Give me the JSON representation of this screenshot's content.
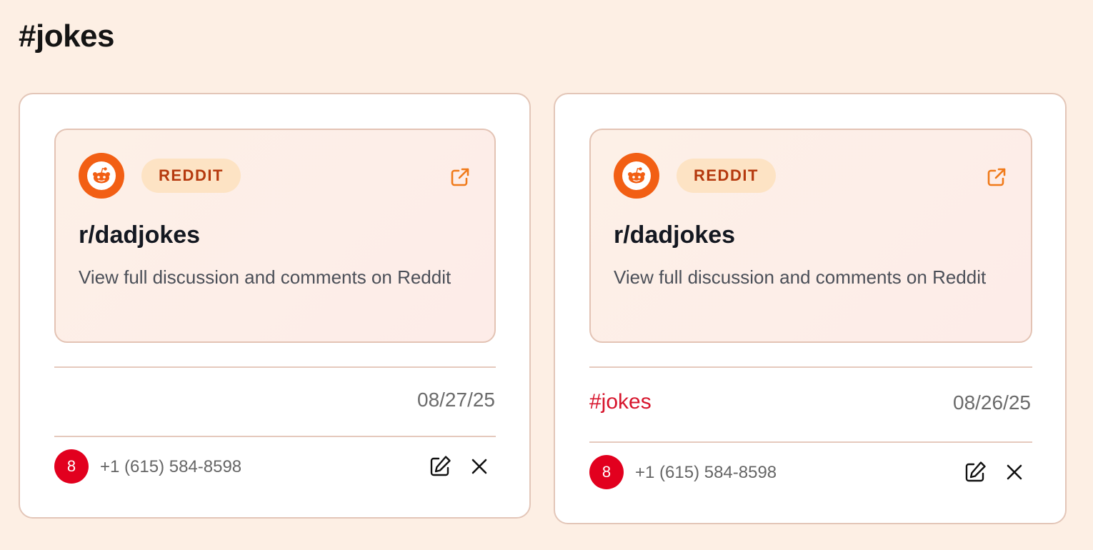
{
  "page": {
    "title": "#jokes"
  },
  "colors": {
    "background": "#fdefe4",
    "reddit_orange": "#f25f14",
    "badge_bg": "#fde3c4",
    "badge_text": "#b5390e",
    "avatar": "#e2001e",
    "tag": "#d7162d"
  },
  "cards": [
    {
      "source_icon": "reddit-logo-icon",
      "badge": "REDDIT",
      "subreddit": "r/dadjokes",
      "description": "View full discussion and comments on Reddit",
      "tag": "",
      "date": "08/27/25",
      "avatar_initial": "8",
      "phone": "+1 (615) 584-8598",
      "actions": [
        "edit-icon",
        "close-icon"
      ]
    },
    {
      "source_icon": "reddit-logo-icon",
      "badge": "REDDIT",
      "subreddit": "r/dadjokes",
      "description": "View full discussion and comments on Reddit",
      "tag": "#jokes",
      "date": "08/26/25",
      "avatar_initial": "8",
      "phone": "+1 (615) 584-8598",
      "actions": [
        "edit-icon",
        "close-icon"
      ]
    }
  ]
}
